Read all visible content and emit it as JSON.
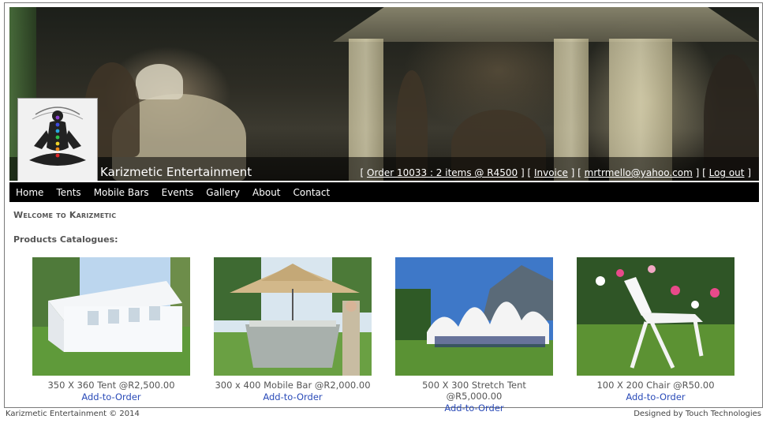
{
  "header": {
    "site_title": "Karizmetic Entertainment",
    "order_link": "Order 10033 : 2 items @ R4500",
    "invoice_link": "Invoice",
    "email_link": "mrtrmello@yahoo.com",
    "logout_link": "Log out"
  },
  "nav": {
    "items": [
      "Home",
      "Tents",
      "Mobile Bars",
      "Events",
      "Gallery",
      "About",
      "Contact"
    ]
  },
  "main": {
    "welcome": "Welcome to Karizmetic",
    "products_heading": "Products Catalogues:",
    "add_label": "Add-to-Order",
    "products": [
      {
        "name": "350 X 360 Tent @R2,500.00",
        "icon": "white-marquee-tent-photo"
      },
      {
        "name": "300 x 400 Mobile Bar @R2,000.00",
        "icon": "mobile-bar-umbrella-photo"
      },
      {
        "name": "500 X 300 Stretch Tent @R5,000.00",
        "icon": "white-stretch-tent-photo"
      },
      {
        "name": "100 X 200 Chair @R50.00",
        "icon": "white-folding-chair-photo"
      }
    ]
  },
  "footer": {
    "copyright": "Karizmetic Entertainment © 2014",
    "credit": "Designed by Touch Technologies"
  },
  "colors": {
    "nav_bg": "#000000",
    "link_blue": "#2a4bb8",
    "text_gray": "#555555"
  }
}
